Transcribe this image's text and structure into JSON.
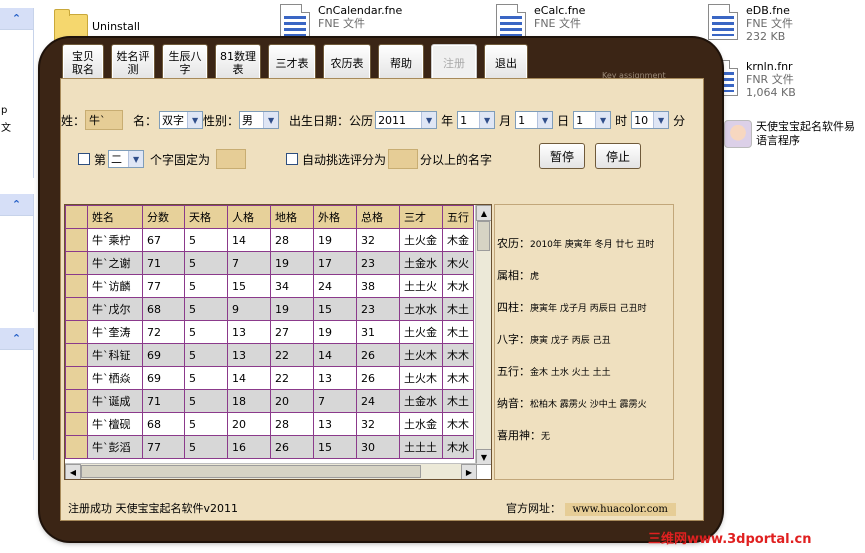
{
  "desktop": {
    "folder": {
      "name": "Uninstall"
    },
    "files_top": [
      {
        "name": "CnCalendar.fne",
        "type": "FNE 文件"
      },
      {
        "name": "eCalc.fne",
        "type": "FNE 文件"
      }
    ],
    "files_right": [
      {
        "name": "eDB.fne",
        "type": "FNE 文件",
        "size": "232 KB"
      },
      {
        "name": "krnln.fnr",
        "type": "FNR 文件",
        "size": "1,064 KB"
      }
    ],
    "shortcut": {
      "name": "天使宝宝起名软件易语言程序"
    },
    "left_panel_text_1": "p",
    "left_panel_text_2": "文"
  },
  "toolbar": {
    "buttons": [
      {
        "label": "宝贝取名"
      },
      {
        "label": "姓名评测"
      },
      {
        "label": "生辰八字"
      },
      {
        "label": "81数理表"
      },
      {
        "label": "三才表"
      },
      {
        "label": "农历表"
      },
      {
        "label": "帮助"
      },
      {
        "label": "注册"
      },
      {
        "label": "退出"
      }
    ],
    "key_label": "Key assignment"
  },
  "form": {
    "surname_label": "姓：",
    "surname_value": "牛`",
    "name_label": "名：",
    "name_type": "双字",
    "gender_label": "性别：",
    "gender": "男",
    "birth_label": "出生日期：公历",
    "year": "2011",
    "year_unit": "年",
    "month": "1",
    "month_unit": "月",
    "day": "1",
    "day_unit": "日",
    "hour": "1",
    "hour_unit": "时",
    "minute": "10",
    "minute_unit": "分",
    "fix_label": "第",
    "fix_index": "二",
    "fix_suffix": "个字固定为",
    "auto_label": "自动挑选评分为",
    "auto_suffix": "分以上的名字",
    "pause_label": "暂停",
    "stop_label": "停止"
  },
  "table": {
    "columns": [
      "姓名",
      "分数",
      "天格",
      "人格",
      "地格",
      "外格",
      "总格",
      "三才",
      "五行"
    ],
    "rows": [
      [
        "牛`乘柠",
        "67",
        "5",
        "14",
        "28",
        "19",
        "32",
        "土火金",
        "木金"
      ],
      [
        "牛`之谢",
        "71",
        "5",
        "7",
        "19",
        "17",
        "23",
        "土金水",
        "木火"
      ],
      [
        "牛`访麟",
        "77",
        "5",
        "15",
        "34",
        "24",
        "38",
        "土土火",
        "木水"
      ],
      [
        "牛`戊尔",
        "68",
        "5",
        "9",
        "19",
        "15",
        "23",
        "土水水",
        "木土"
      ],
      [
        "牛`奎涛",
        "72",
        "5",
        "13",
        "27",
        "19",
        "31",
        "土火金",
        "木土"
      ],
      [
        "牛`科钲",
        "69",
        "5",
        "13",
        "22",
        "14",
        "26",
        "土火木",
        "木木"
      ],
      [
        "牛`栖焱",
        "69",
        "5",
        "14",
        "22",
        "13",
        "26",
        "土火木",
        "木木"
      ],
      [
        "牛`诞成",
        "71",
        "5",
        "18",
        "20",
        "7",
        "24",
        "土金水",
        "木土"
      ],
      [
        "牛`檀砚",
        "68",
        "5",
        "20",
        "28",
        "13",
        "32",
        "土水金",
        "木木"
      ],
      [
        "牛`彭滔",
        "77",
        "5",
        "16",
        "26",
        "15",
        "30",
        "土土土",
        "木水"
      ]
    ]
  },
  "info": {
    "lunar_label": "农历：",
    "lunar_value": "2010年 庚寅年 冬月 廿七 丑时",
    "zodiac_label": "属相：",
    "zodiac_value": "虎",
    "pillars_label": "四柱：",
    "pillars_value": "庚寅年 戊子月 丙辰日 己丑时",
    "bazi_label": "八字：",
    "bazi_value": "庚寅 戊子 丙辰 己丑",
    "wuxing_label": "五行：",
    "wuxing_value": "金木 土水 火土 土土",
    "nayin_label": "纳音：",
    "nayin_value": "松柏木 霹雳火 沙中土 霹雳火",
    "xiyong_label": "喜用神：",
    "xiyong_value": "无"
  },
  "footer": {
    "status": "注册成功  天使宝宝起名软件v2011",
    "site_label": "官方网址：",
    "site_url": "www.huacolor.com"
  },
  "watermark": "三维网www.3dportal.cn",
  "colors": {
    "frame": "#3b2515",
    "parchment": "#efe0bf",
    "header": "#e7d19a",
    "grid": "#8b3a8b"
  }
}
